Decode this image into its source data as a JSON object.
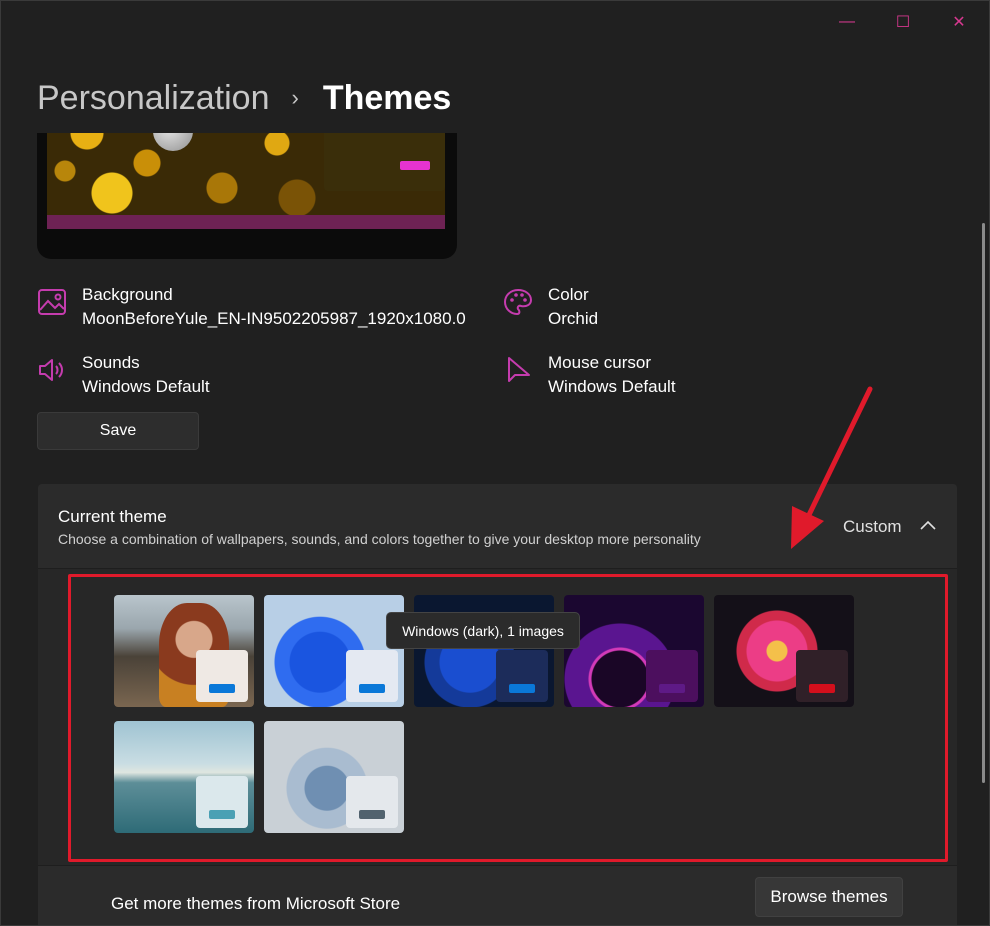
{
  "window": {
    "controls": {
      "minimize": "—",
      "maximize": "☐",
      "close": "✕"
    }
  },
  "breadcrumb": {
    "parent": "Personalization",
    "separator": "›",
    "current": "Themes"
  },
  "properties": {
    "background": {
      "title": "Background",
      "value": "MoonBeforeYule_EN-IN9502205987_1920x1080.0"
    },
    "color": {
      "title": "Color",
      "value": "Orchid"
    },
    "sounds": {
      "title": "Sounds",
      "value": "Windows Default"
    },
    "mouse_cursor": {
      "title": "Mouse cursor",
      "value": "Windows Default"
    }
  },
  "save_label": "Save",
  "current_theme": {
    "title": "Current theme",
    "subtitle": "Choose a combination of wallpapers, sounds, and colors together to give your desktop more personality",
    "value": "Custom"
  },
  "themes": [
    {
      "name": "theme-custom-photo",
      "accent": "#0a78d8"
    },
    {
      "name": "theme-windows-light",
      "accent": "#0a78d8"
    },
    {
      "name": "theme-windows-dark",
      "accent": "#0a78d8"
    },
    {
      "name": "theme-glow",
      "accent": "#5e1a86"
    },
    {
      "name": "theme-captured-motion",
      "accent": "#d40f1c"
    },
    {
      "name": "theme-sunrise",
      "accent": "#4aa0b4"
    },
    {
      "name": "theme-flow",
      "accent": "#51626e"
    }
  ],
  "tooltip": "Windows (dark), 1 images",
  "store": {
    "text": "Get more themes from Microsoft Store",
    "button": "Browse themes"
  },
  "colors": {
    "accent_icon": "#c53cae",
    "annotation": "#e01a2b"
  }
}
